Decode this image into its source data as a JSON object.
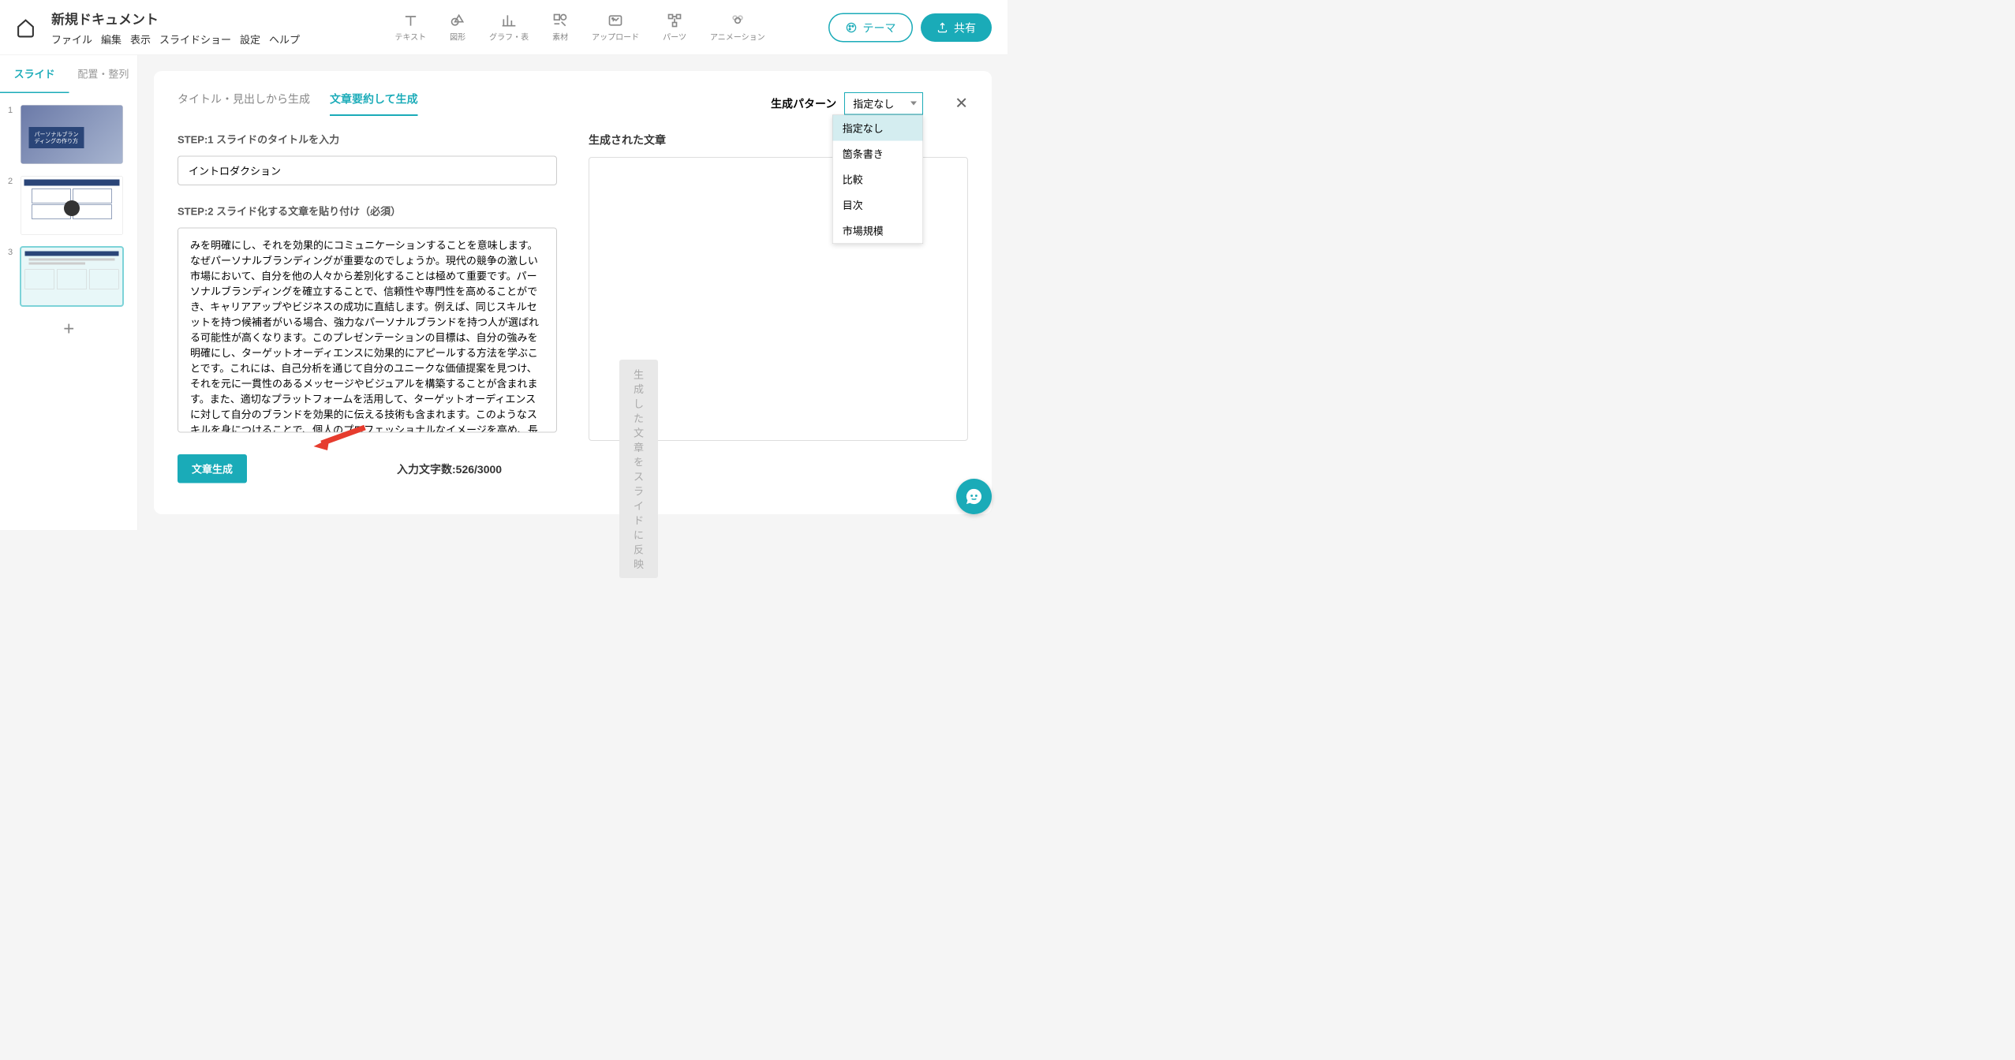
{
  "doc_title": "新規ドキュメント",
  "menu": {
    "file": "ファイル",
    "edit": "編集",
    "view": "表示",
    "slideshow": "スライドショー",
    "settings": "設定",
    "help": "ヘルプ"
  },
  "tools": {
    "text": "テキスト",
    "shape": "図形",
    "chart": "グラフ・表",
    "assets": "素材",
    "upload": "アップロード",
    "parts": "パーツ",
    "animation": "アニメーション"
  },
  "actions": {
    "theme": "テーマ",
    "share": "共有"
  },
  "side_tabs": {
    "slide": "スライド",
    "arrange": "配置・整列"
  },
  "thumbs": {
    "t1_line1": "パーソナルブラン",
    "t1_line2": "ディングの作り方"
  },
  "gen_tabs": {
    "title": "タイトル・見出しから生成",
    "summary": "文章要約して生成"
  },
  "pattern": {
    "label": "生成パターン",
    "selected": "指定なし",
    "options": [
      "指定なし",
      "箇条書き",
      "比較",
      "目次",
      "市場規模"
    ]
  },
  "form": {
    "step1_label": "STEP:1 スライドのタイトルを入力",
    "step1_value": "イントロダクション",
    "step2_label": "STEP:2 スライド化する文章を貼り付け（必須）",
    "step2_value": "みを明確にし、それを効果的にコミュニケーションすることを意味します。なぜパーソナルブランディングが重要なのでしょうか。現代の競争の激しい市場において、自分を他の人々から差別化することは極めて重要です。パーソナルブランディングを確立することで、信頼性や専門性を高めることができ、キャリアアップやビジネスの成功に直結します。例えば、同じスキルセットを持つ候補者がいる場合、強力なパーソナルブランドを持つ人が選ばれる可能性が高くなります。このプレゼンテーションの目標は、自分の強みを明確にし、ターゲットオーディエンスに効果的にアピールする方法を学ぶことです。これには、自己分析を通じて自分のユニークな価値提案を見つけ、それを元に一貫性のあるメッセージやビジュアルを構築することが含まれます。また、適切なプラットフォームを活用して、ターゲットオーディエンスに対して自分のブランドを効果的に伝える技術も含まれます。このようなスキルを身につけることで、個人のプロフェッショナルなイメージを高め、長期的な成功を実現することができます。",
    "generated_title": "生成された文章",
    "char_count": "入力文字数:526/3000",
    "generate_btn": "文章生成",
    "apply_btn": "生成した文章をスライドに反映"
  }
}
